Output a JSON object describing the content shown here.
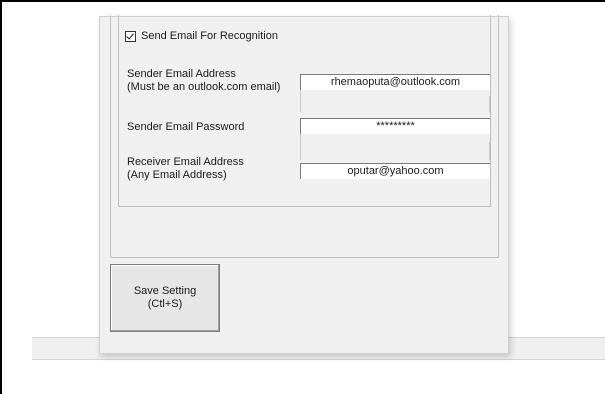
{
  "email_settings": {
    "send_email_checkbox": {
      "label": "Send Email For Recognition",
      "checked": true
    },
    "sender_email": {
      "label_line1": "Sender Email Address",
      "label_line2": "(Must be an outlook.com email)",
      "value": "rhemaoputa@outlook.com"
    },
    "sender_password": {
      "label": "Sender Email Password",
      "value": "*********"
    },
    "receiver_email": {
      "label_line1": "Receiver Email Address",
      "label_line2": "(Any Email Address)",
      "value": "oputar@yahoo.com"
    }
  },
  "save_button": {
    "line1": "Save Setting",
    "line2": "(Ctl+S)"
  }
}
